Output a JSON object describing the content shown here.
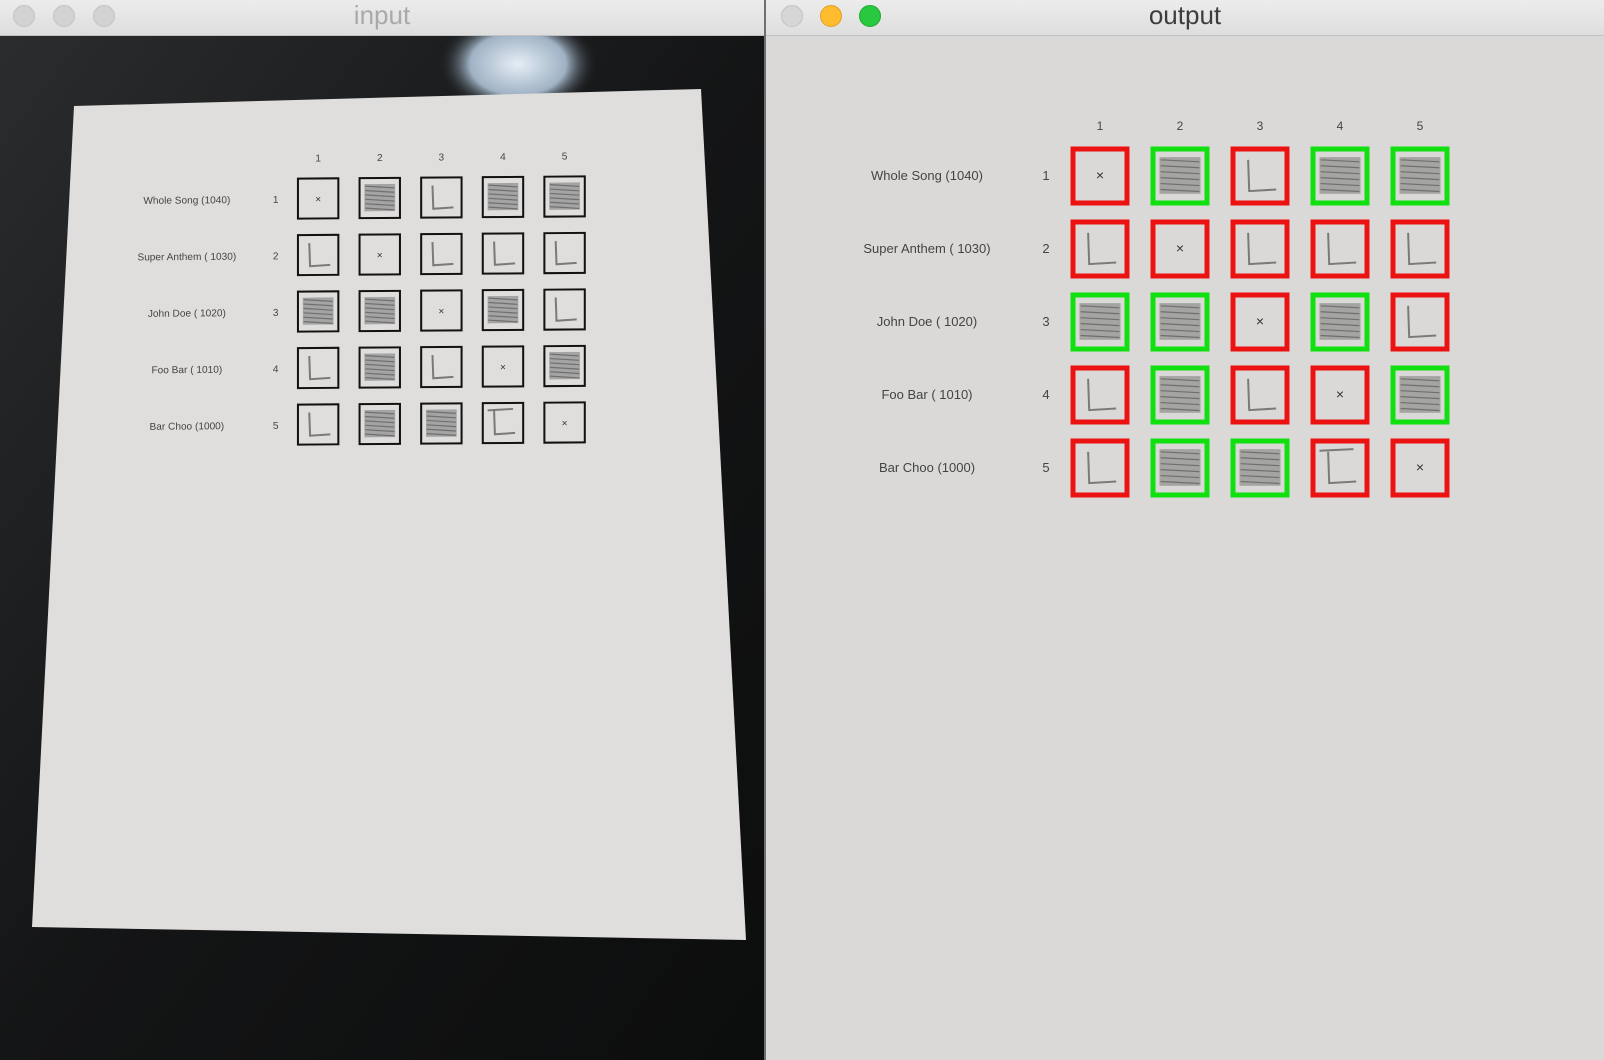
{
  "windows": {
    "input": {
      "title": "input"
    },
    "output": {
      "title": "output"
    }
  },
  "sheet": {
    "column_headers": [
      "1",
      "2",
      "3",
      "4",
      "5"
    ],
    "rows": [
      {
        "name": "Whole Song (1040)",
        "number": "1",
        "marks": [
          "x",
          "fill",
          "L",
          "fill",
          "fill"
        ]
      },
      {
        "name": "Super Anthem ( 1030)",
        "number": "2",
        "marks": [
          "L",
          "x",
          "L",
          "L",
          "L"
        ]
      },
      {
        "name": "John Doe ( 1020)",
        "number": "3",
        "marks": [
          "fill",
          "fill",
          "x",
          "fill",
          "L"
        ]
      },
      {
        "name": "Foo Bar ( 1010)",
        "number": "4",
        "marks": [
          "L",
          "fill",
          "L",
          "x",
          "fill"
        ]
      },
      {
        "name": "Bar Choo (1000)",
        "number": "5",
        "marks": [
          "L",
          "fill",
          "fill",
          "T",
          "x"
        ]
      }
    ]
  },
  "colors": {
    "selected_box": "#10e010",
    "unselected_box": "#ec1212",
    "paper": "#dedcda",
    "table": "#111111"
  }
}
